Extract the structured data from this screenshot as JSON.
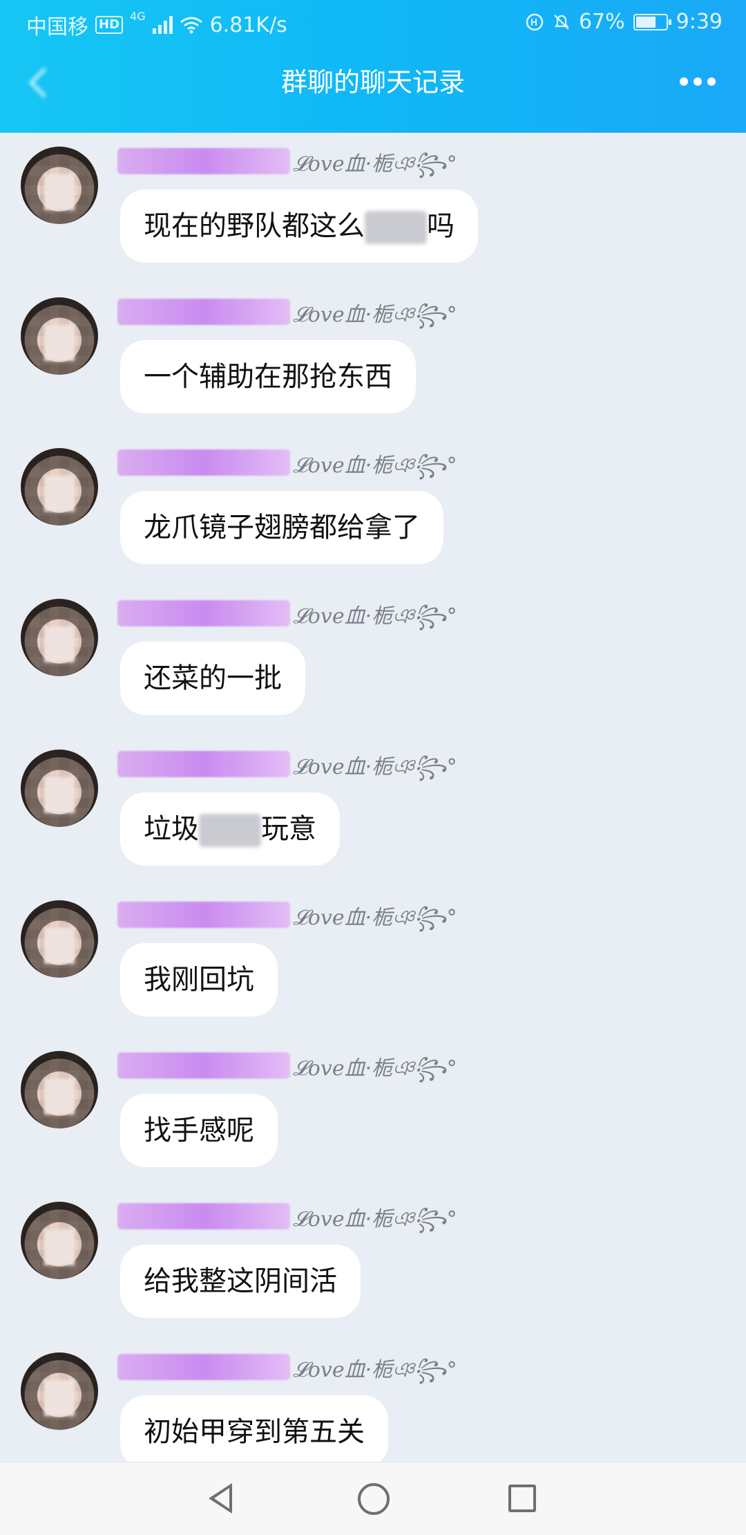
{
  "status": {
    "carrier": "中国移",
    "network_badge": "HD",
    "network_type": "4G",
    "speed": "6.81K/s",
    "battery": "67%",
    "time": "9:39"
  },
  "header": {
    "title": "群聊的聊天记录"
  },
  "nickname_suffix": "𝓛ove血·栀ঞ꧂°",
  "messages": [
    {
      "text_before": "现在的野队都这么",
      "masked": true,
      "text_after": "吗"
    },
    {
      "text_before": "一个辅助在那抢东西",
      "masked": false,
      "text_after": ""
    },
    {
      "text_before": "龙爪镜子翅膀都给拿了",
      "masked": false,
      "text_after": ""
    },
    {
      "text_before": "还菜的一批",
      "masked": false,
      "text_after": ""
    },
    {
      "text_before": "垃圾",
      "masked": true,
      "text_after": "玩意"
    },
    {
      "text_before": "我刚回坑",
      "masked": false,
      "text_after": ""
    },
    {
      "text_before": "找手感呢",
      "masked": false,
      "text_after": ""
    },
    {
      "text_before": "给我整这阴间活",
      "masked": false,
      "text_after": ""
    },
    {
      "text_before": "初始甲穿到第五关",
      "masked": false,
      "text_after": ""
    }
  ],
  "colors": {
    "header_gradient_start": "#16c6f4",
    "header_gradient_end": "#1aa9f7",
    "chat_background": "#e9edf4",
    "bubble": "#ffffff"
  }
}
